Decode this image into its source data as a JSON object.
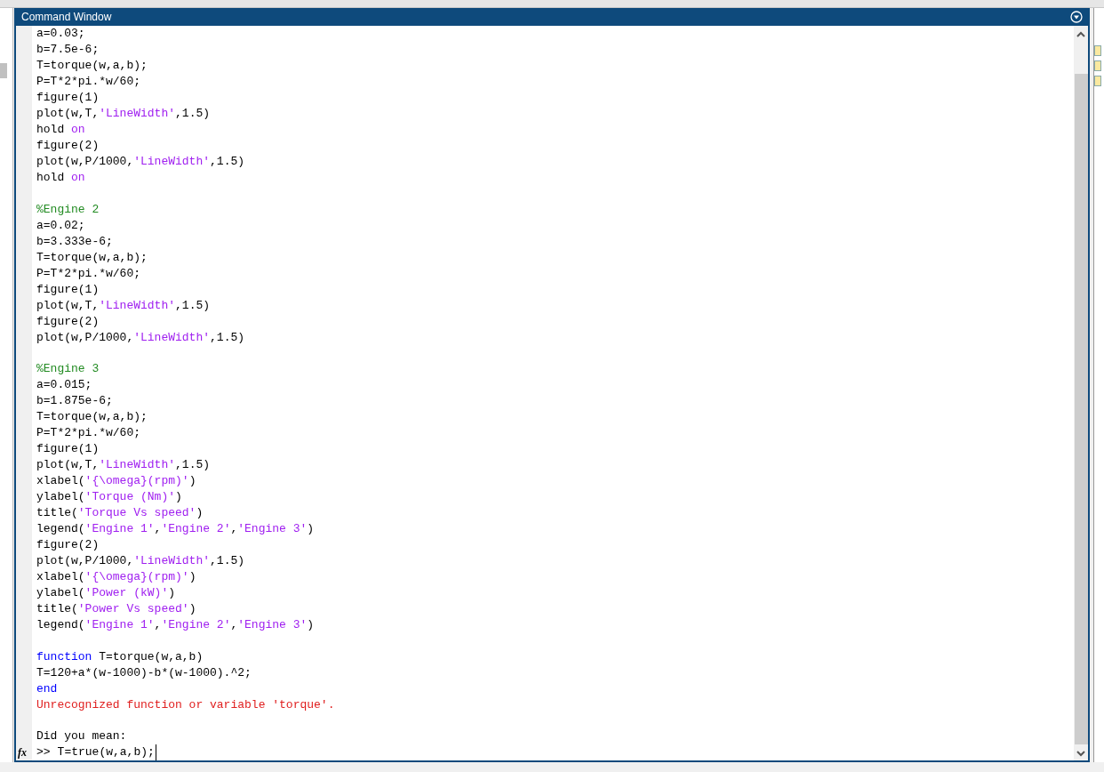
{
  "window": {
    "title": "Command Window"
  },
  "lines": [
    {
      "kind": "text",
      "segments": [
        {
          "kind": "code",
          "text": "a=0.03;"
        }
      ]
    },
    {
      "kind": "text",
      "segments": [
        {
          "kind": "code",
          "text": "b=7.5e-6;"
        }
      ]
    },
    {
      "kind": "text",
      "segments": [
        {
          "kind": "code",
          "text": "T=torque(w,a,b);"
        }
      ]
    },
    {
      "kind": "text",
      "segments": [
        {
          "kind": "code",
          "text": "P=T*2*pi.*w/60;"
        }
      ]
    },
    {
      "kind": "text",
      "segments": [
        {
          "kind": "code",
          "text": "figure(1)"
        }
      ]
    },
    {
      "kind": "text",
      "segments": [
        {
          "kind": "code",
          "text": "plot(w,T,"
        },
        {
          "kind": "string",
          "text": "'LineWidth'"
        },
        {
          "kind": "code",
          "text": ",1.5)"
        }
      ]
    },
    {
      "kind": "text",
      "segments": [
        {
          "kind": "code",
          "text": "hold "
        },
        {
          "kind": "string",
          "text": "on"
        }
      ]
    },
    {
      "kind": "text",
      "segments": [
        {
          "kind": "code",
          "text": "figure(2)"
        }
      ]
    },
    {
      "kind": "text",
      "segments": [
        {
          "kind": "code",
          "text": "plot(w,P/1000,"
        },
        {
          "kind": "string",
          "text": "'LineWidth'"
        },
        {
          "kind": "code",
          "text": ",1.5)"
        }
      ]
    },
    {
      "kind": "text",
      "segments": [
        {
          "kind": "code",
          "text": "hold "
        },
        {
          "kind": "string",
          "text": "on"
        }
      ]
    },
    {
      "kind": "blank"
    },
    {
      "kind": "text",
      "segments": [
        {
          "kind": "comment",
          "text": "%Engine 2"
        }
      ]
    },
    {
      "kind": "text",
      "segments": [
        {
          "kind": "code",
          "text": "a=0.02;"
        }
      ]
    },
    {
      "kind": "text",
      "segments": [
        {
          "kind": "code",
          "text": "b=3.333e-6;"
        }
      ]
    },
    {
      "kind": "text",
      "segments": [
        {
          "kind": "code",
          "text": "T=torque(w,a,b);"
        }
      ]
    },
    {
      "kind": "text",
      "segments": [
        {
          "kind": "code",
          "text": "P=T*2*pi.*w/60;"
        }
      ]
    },
    {
      "kind": "text",
      "segments": [
        {
          "kind": "code",
          "text": "figure(1)"
        }
      ]
    },
    {
      "kind": "text",
      "segments": [
        {
          "kind": "code",
          "text": "plot(w,T,"
        },
        {
          "kind": "string",
          "text": "'LineWidth'"
        },
        {
          "kind": "code",
          "text": ",1.5)"
        }
      ]
    },
    {
      "kind": "text",
      "segments": [
        {
          "kind": "code",
          "text": "figure(2)"
        }
      ]
    },
    {
      "kind": "text",
      "segments": [
        {
          "kind": "code",
          "text": "plot(w,P/1000,"
        },
        {
          "kind": "string",
          "text": "'LineWidth'"
        },
        {
          "kind": "code",
          "text": ",1.5)"
        }
      ]
    },
    {
      "kind": "blank"
    },
    {
      "kind": "text",
      "segments": [
        {
          "kind": "comment",
          "text": "%Engine 3"
        }
      ]
    },
    {
      "kind": "text",
      "segments": [
        {
          "kind": "code",
          "text": "a=0.015;"
        }
      ]
    },
    {
      "kind": "text",
      "segments": [
        {
          "kind": "code",
          "text": "b=1.875e-6;"
        }
      ]
    },
    {
      "kind": "text",
      "segments": [
        {
          "kind": "code",
          "text": "T=torque(w,a,b);"
        }
      ]
    },
    {
      "kind": "text",
      "segments": [
        {
          "kind": "code",
          "text": "P=T*2*pi.*w/60;"
        }
      ]
    },
    {
      "kind": "text",
      "segments": [
        {
          "kind": "code",
          "text": "figure(1)"
        }
      ]
    },
    {
      "kind": "text",
      "segments": [
        {
          "kind": "code",
          "text": "plot(w,T,"
        },
        {
          "kind": "string",
          "text": "'LineWidth'"
        },
        {
          "kind": "code",
          "text": ",1.5)"
        }
      ]
    },
    {
      "kind": "text",
      "segments": [
        {
          "kind": "code",
          "text": "xlabel("
        },
        {
          "kind": "string",
          "text": "'{\\omega}(rpm)'"
        },
        {
          "kind": "code",
          "text": ")"
        }
      ]
    },
    {
      "kind": "text",
      "segments": [
        {
          "kind": "code",
          "text": "ylabel("
        },
        {
          "kind": "string",
          "text": "'Torque (Nm)'"
        },
        {
          "kind": "code",
          "text": ")"
        }
      ]
    },
    {
      "kind": "text",
      "segments": [
        {
          "kind": "code",
          "text": "title("
        },
        {
          "kind": "string",
          "text": "'Torque Vs speed'"
        },
        {
          "kind": "code",
          "text": ")"
        }
      ]
    },
    {
      "kind": "text",
      "segments": [
        {
          "kind": "code",
          "text": "legend("
        },
        {
          "kind": "string",
          "text": "'Engine 1'"
        },
        {
          "kind": "code",
          "text": ","
        },
        {
          "kind": "string",
          "text": "'Engine 2'"
        },
        {
          "kind": "code",
          "text": ","
        },
        {
          "kind": "string",
          "text": "'Engine 3'"
        },
        {
          "kind": "code",
          "text": ")"
        }
      ]
    },
    {
      "kind": "text",
      "segments": [
        {
          "kind": "code",
          "text": "figure(2)"
        }
      ]
    },
    {
      "kind": "text",
      "segments": [
        {
          "kind": "code",
          "text": "plot(w,P/1000,"
        },
        {
          "kind": "string",
          "text": "'LineWidth'"
        },
        {
          "kind": "code",
          "text": ",1.5)"
        }
      ]
    },
    {
      "kind": "text",
      "segments": [
        {
          "kind": "code",
          "text": "xlabel("
        },
        {
          "kind": "string",
          "text": "'{\\omega}(rpm)'"
        },
        {
          "kind": "code",
          "text": ")"
        }
      ]
    },
    {
      "kind": "text",
      "segments": [
        {
          "kind": "code",
          "text": "ylabel("
        },
        {
          "kind": "string",
          "text": "'Power (kW)'"
        },
        {
          "kind": "code",
          "text": ")"
        }
      ]
    },
    {
      "kind": "text",
      "segments": [
        {
          "kind": "code",
          "text": "title("
        },
        {
          "kind": "string",
          "text": "'Power Vs speed'"
        },
        {
          "kind": "code",
          "text": ")"
        }
      ]
    },
    {
      "kind": "text",
      "segments": [
        {
          "kind": "code",
          "text": "legend("
        },
        {
          "kind": "string",
          "text": "'Engine 1'"
        },
        {
          "kind": "code",
          "text": ","
        },
        {
          "kind": "string",
          "text": "'Engine 2'"
        },
        {
          "kind": "code",
          "text": ","
        },
        {
          "kind": "string",
          "text": "'Engine 3'"
        },
        {
          "kind": "code",
          "text": ")"
        }
      ]
    },
    {
      "kind": "blank"
    },
    {
      "kind": "text",
      "segments": [
        {
          "kind": "keyword",
          "text": "function"
        },
        {
          "kind": "code",
          "text": " T=torque(w,a,b)"
        }
      ]
    },
    {
      "kind": "text",
      "segments": [
        {
          "kind": "code",
          "text": "T=120+a*(w-1000)-b*(w-1000).^2;"
        }
      ]
    },
    {
      "kind": "text",
      "segments": [
        {
          "kind": "keyword",
          "text": "end"
        }
      ]
    },
    {
      "kind": "text",
      "segments": [
        {
          "kind": "error",
          "text": "Unrecognized function or variable 'torque'."
        }
      ]
    },
    {
      "kind": "blank"
    },
    {
      "kind": "text",
      "segments": [
        {
          "kind": "code",
          "text": "Did you mean:"
        }
      ]
    }
  ],
  "prompt": {
    "function_icon": "fx",
    "symbol": ">>",
    "input": "T=true(w,a,b);"
  }
}
